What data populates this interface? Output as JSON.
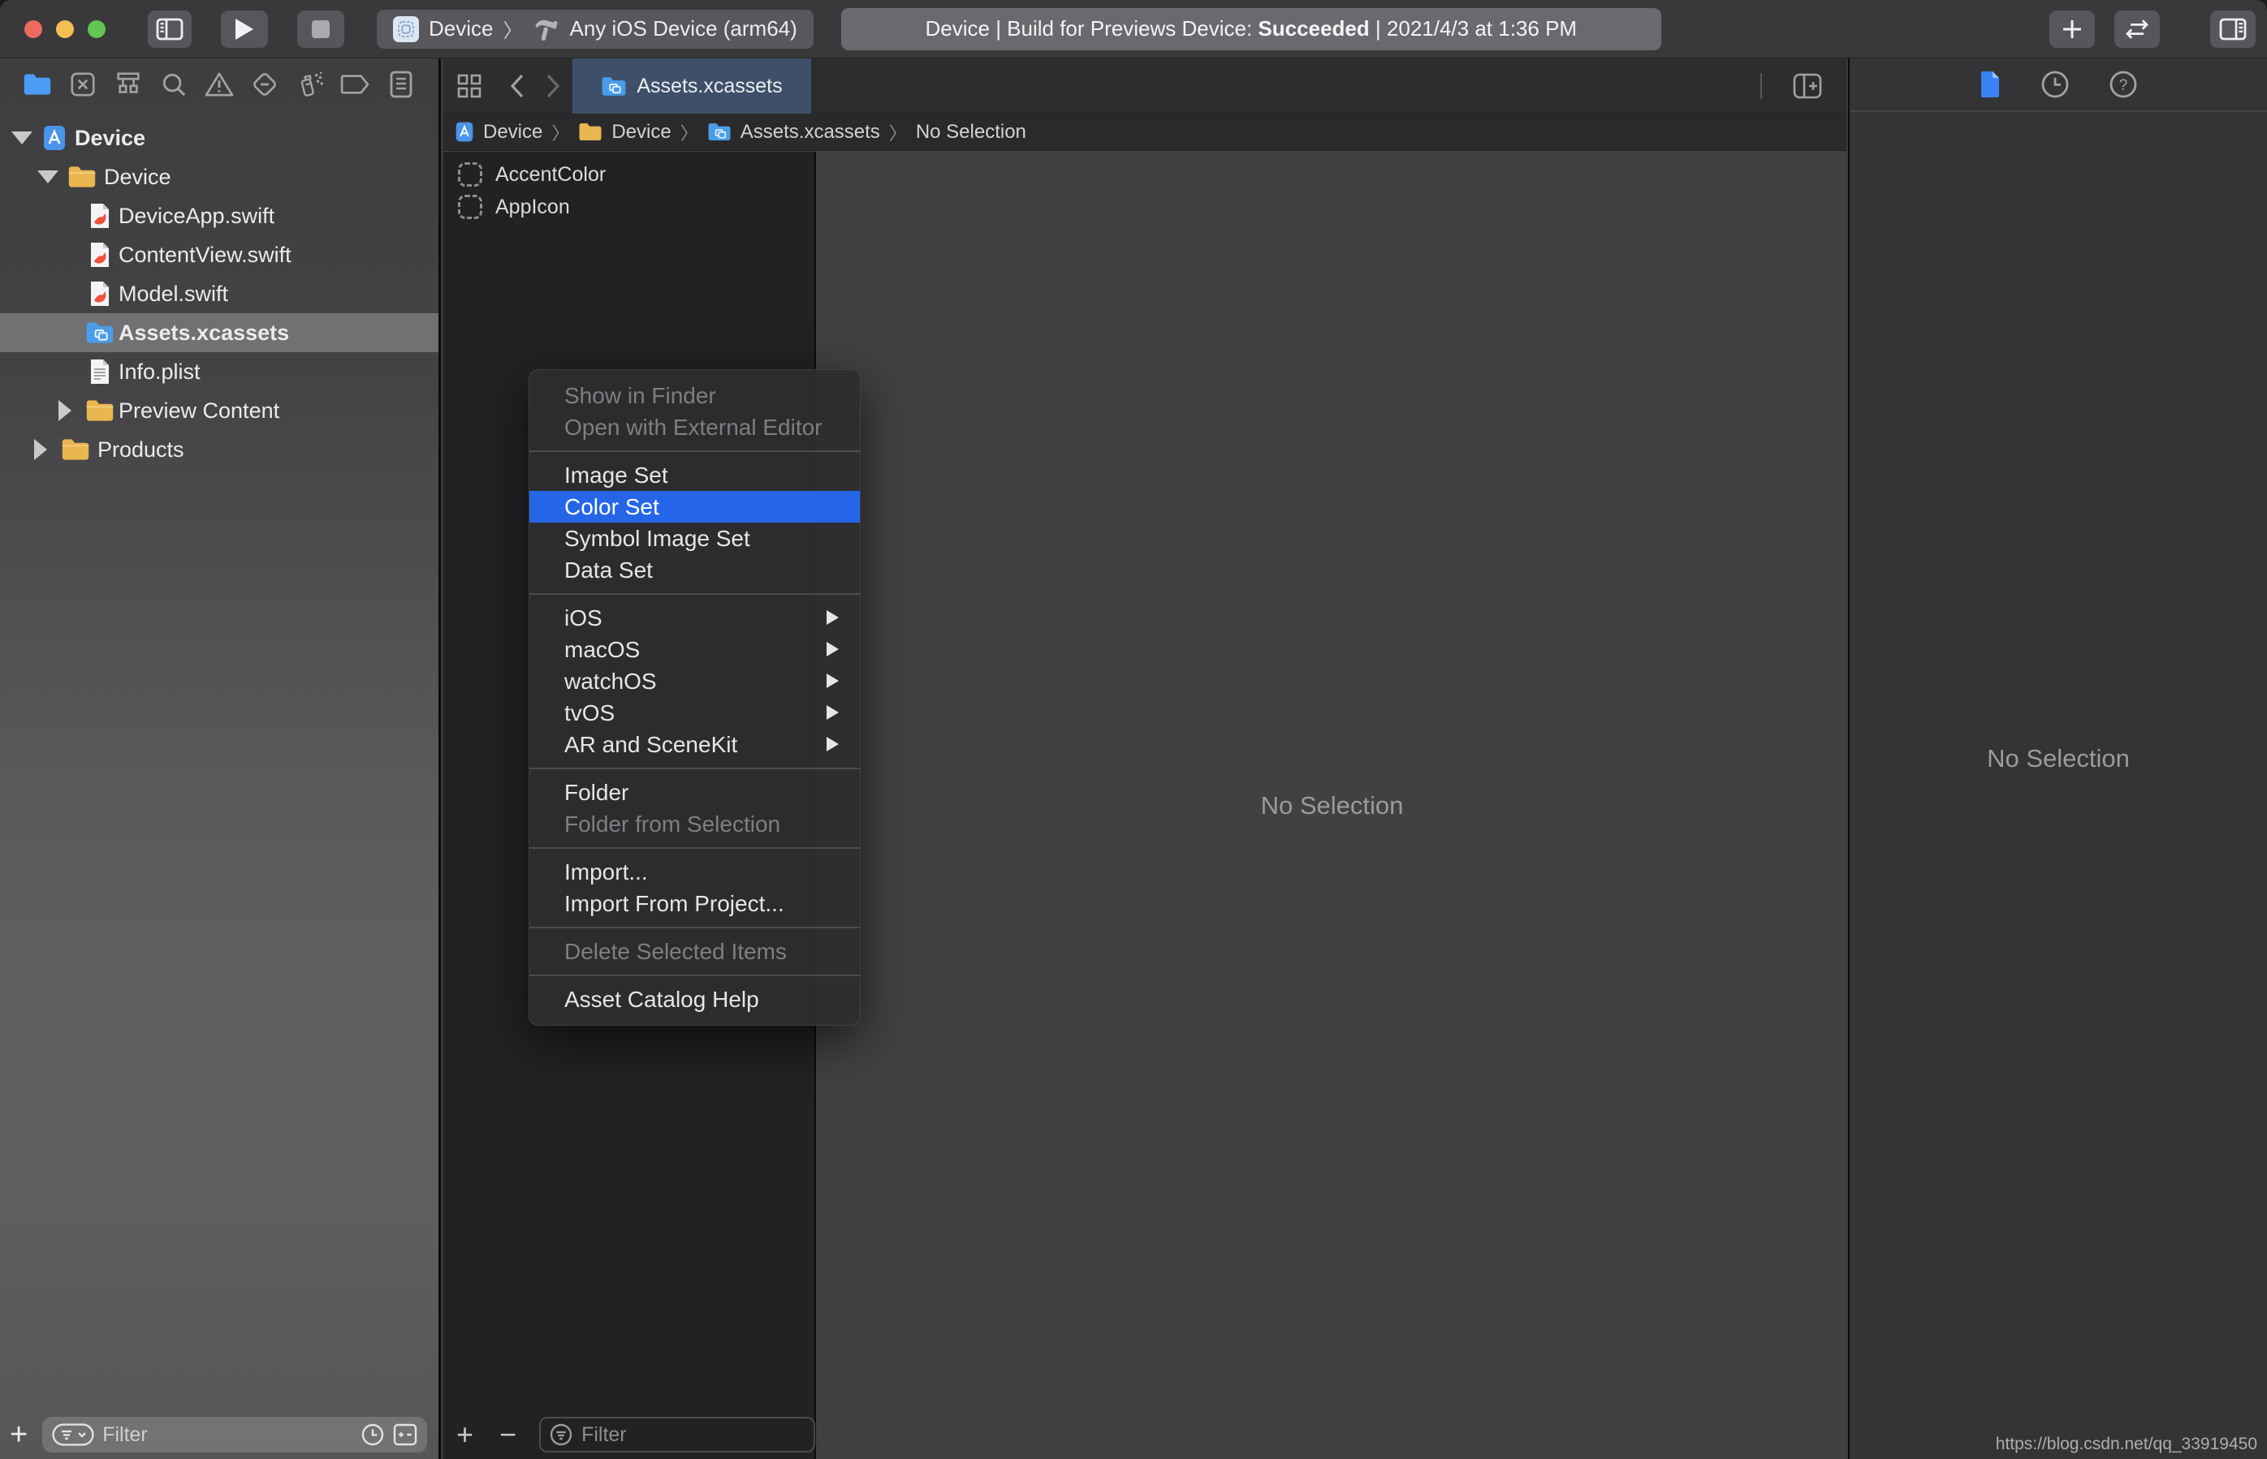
{
  "toolbar": {
    "scheme": {
      "project": "Device",
      "chevron": "〉",
      "destination": "Any iOS Device (arm64)"
    },
    "status": {
      "prefix": "Device | Build for Previews Device: ",
      "result": "Succeeded",
      "suffix": " | 2021/4/3 at 1:36 PM"
    }
  },
  "navigator": {
    "tree": [
      {
        "label": "Device"
      },
      {
        "label": "Device"
      },
      {
        "label": "DeviceApp.swift"
      },
      {
        "label": "ContentView.swift"
      },
      {
        "label": "Model.swift"
      },
      {
        "label": "Assets.xcassets"
      },
      {
        "label": "Info.plist"
      },
      {
        "label": "Preview Content"
      },
      {
        "label": "Products"
      }
    ],
    "filter_placeholder": "Filter"
  },
  "tabbar": {
    "active_tab": "Assets.xcassets"
  },
  "jumpbar": {
    "segments": [
      "Device",
      "Device",
      "Assets.xcassets",
      "No Selection"
    ],
    "chevron": "〉"
  },
  "assets": {
    "items": [
      "AccentColor",
      "AppIcon"
    ],
    "filter_placeholder": "Filter"
  },
  "editor": {
    "empty_text": "No Selection"
  },
  "inspector": {
    "empty_text": "No Selection"
  },
  "context_menu": {
    "items": [
      {
        "label": "Show in Finder",
        "state": "disabled"
      },
      {
        "label": "Open with External Editor",
        "state": "disabled"
      },
      {
        "label": "Image Set",
        "state": "normal"
      },
      {
        "label": "Color Set",
        "state": "highlighted"
      },
      {
        "label": "Symbol Image Set",
        "state": "normal"
      },
      {
        "label": "Data Set",
        "state": "normal"
      },
      {
        "label": "iOS",
        "state": "submenu"
      },
      {
        "label": "macOS",
        "state": "submenu"
      },
      {
        "label": "watchOS",
        "state": "submenu"
      },
      {
        "label": "tvOS",
        "state": "submenu"
      },
      {
        "label": "AR and SceneKit",
        "state": "submenu"
      },
      {
        "label": "Folder",
        "state": "normal"
      },
      {
        "label": "Folder from Selection",
        "state": "disabled"
      },
      {
        "label": "Import...",
        "state": "normal"
      },
      {
        "label": "Import From Project...",
        "state": "normal"
      },
      {
        "label": "Delete Selected Items",
        "state": "disabled"
      },
      {
        "label": "Asset Catalog Help",
        "state": "normal"
      }
    ]
  },
  "watermark": "https://blog.csdn.net/qq_33919450",
  "colors": {
    "menu_highlight": "#2566e8",
    "tab_selected": "#3e5069",
    "traffic_red": "#ed6a5f",
    "traffic_yellow": "#f5bf4f",
    "traffic_green": "#62c554",
    "folder_yellow": "#e9b64f",
    "assets_blue": "#4a9de8",
    "swift_orange": "#f05138"
  },
  "icons": {
    "toolbar": [
      "navigator-toggle-icon",
      "play-icon",
      "stop-icon",
      "app-scheme-icon",
      "hammer-icon",
      "plus-icon",
      "swap-arrows-icon",
      "inspectors-toggle-icon"
    ],
    "navigator_tabs": [
      "project-navigator-icon",
      "source-control-icon",
      "symbol-navigator-icon",
      "search-icon",
      "issue-navigator-icon",
      "test-navigator-icon",
      "debug-navigator-icon",
      "breakpoint-navigator-icon",
      "report-navigator-icon"
    ],
    "inspector_tabs": [
      "file-inspector-icon",
      "history-inspector-icon",
      "help-inspector-icon"
    ]
  }
}
